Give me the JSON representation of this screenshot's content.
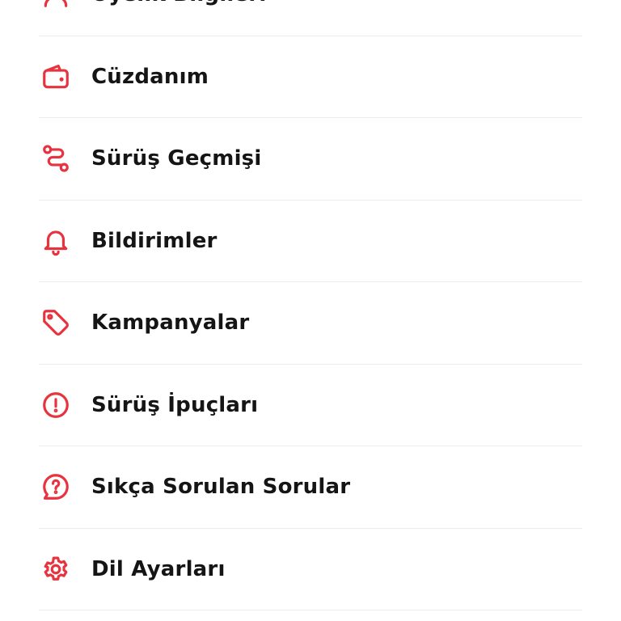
{
  "menu": {
    "items": [
      {
        "label": "Üyelik Bilgileri",
        "icon": "user-icon"
      },
      {
        "label": "Cüzdanım",
        "icon": "wallet-icon"
      },
      {
        "label": "Sürüş Geçmişi",
        "icon": "route-icon"
      },
      {
        "label": "Bildirimler",
        "icon": "bell-icon"
      },
      {
        "label": "Kampanyalar",
        "icon": "tag-icon"
      },
      {
        "label": "Sürüş İpuçları",
        "icon": "alert-circle-icon"
      },
      {
        "label": "Sıkça Sorulan Sorular",
        "icon": "question-bubble-icon"
      },
      {
        "label": "Dil Ayarları",
        "icon": "gear-icon"
      }
    ]
  },
  "colors": {
    "accent": "#e8323e",
    "text": "#151515",
    "divider": "#ececec"
  }
}
